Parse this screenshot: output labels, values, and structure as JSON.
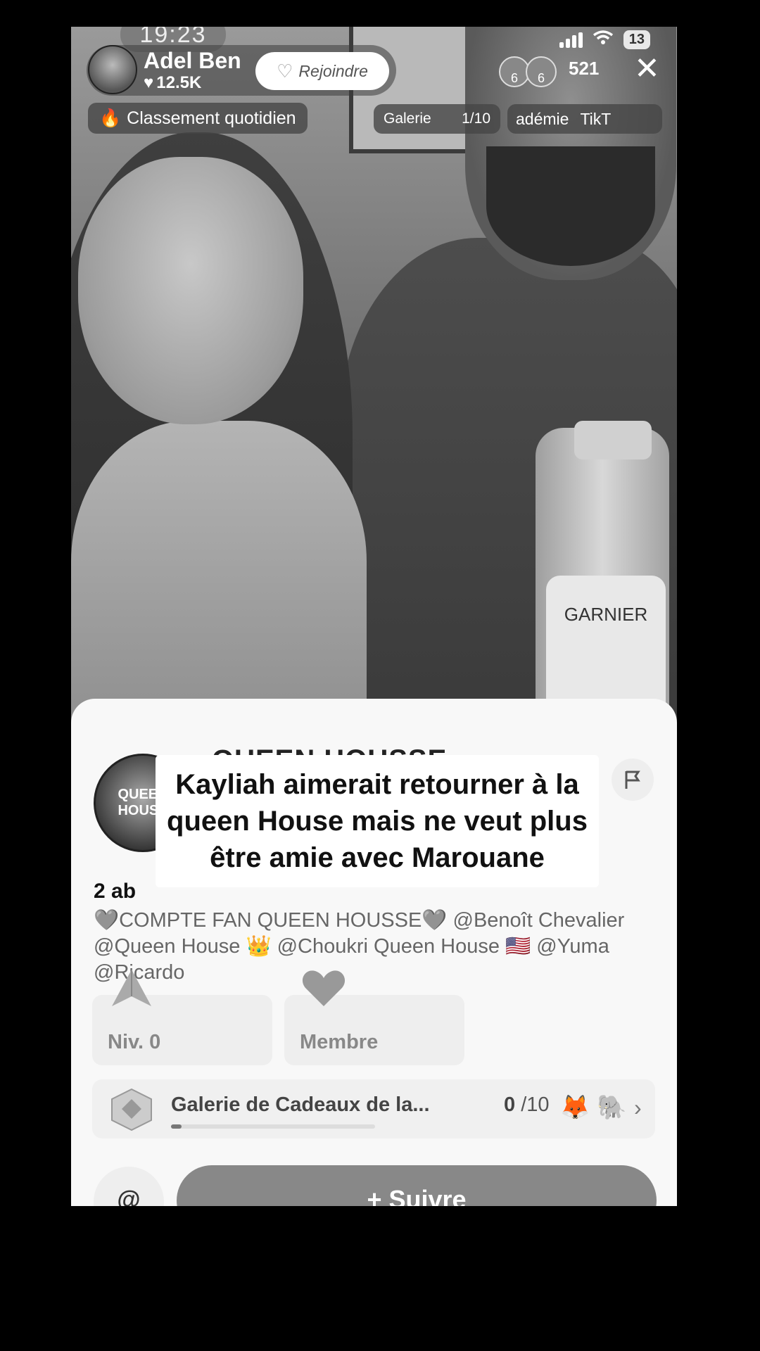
{
  "status": {
    "time": "19:23",
    "battery": "13"
  },
  "host": {
    "name": "Adel Ben",
    "likes": "12.5K",
    "join_label": "Rejoindre",
    "viewer_badges": [
      "6",
      "6"
    ],
    "viewer_count": "521"
  },
  "top_bar": {
    "ranking_label": "Classement quotidien",
    "gallery_label": "Galerie",
    "gallery_count": "1/10",
    "ticker_items": [
      "adémie",
      "TikT"
    ]
  },
  "video": {
    "bottle_label": "GARNIER"
  },
  "club": {
    "avatar_text": "QUEEN HOUSE",
    "name": "QUEEN HOUSSE",
    "subscribers_prefix": "2 ab",
    "bio": "🩶COMPTE FAN QUEEN HOUSSE🩶 @Benoît Chevalier @Queen House 👑 @Choukri Queen House 🇺🇸 @Yuma @Ricardo"
  },
  "caption": {
    "text": "Kayliah aimerait retourner à la queen House mais ne veut plus être amie avec Marouane"
  },
  "cards": {
    "level_label": "Niv. 0",
    "member_label": "Membre"
  },
  "gift_gallery": {
    "title": "Galerie de Cadeaux de la...",
    "count": "0",
    "total": "/10",
    "progress": 0.05
  },
  "actions": {
    "mention_label": "@",
    "follow_label": "+ Suivre"
  },
  "colors": {
    "sheet_bg": "#f8f8f8",
    "follow_bg": "#888888",
    "background": "#000000"
  }
}
